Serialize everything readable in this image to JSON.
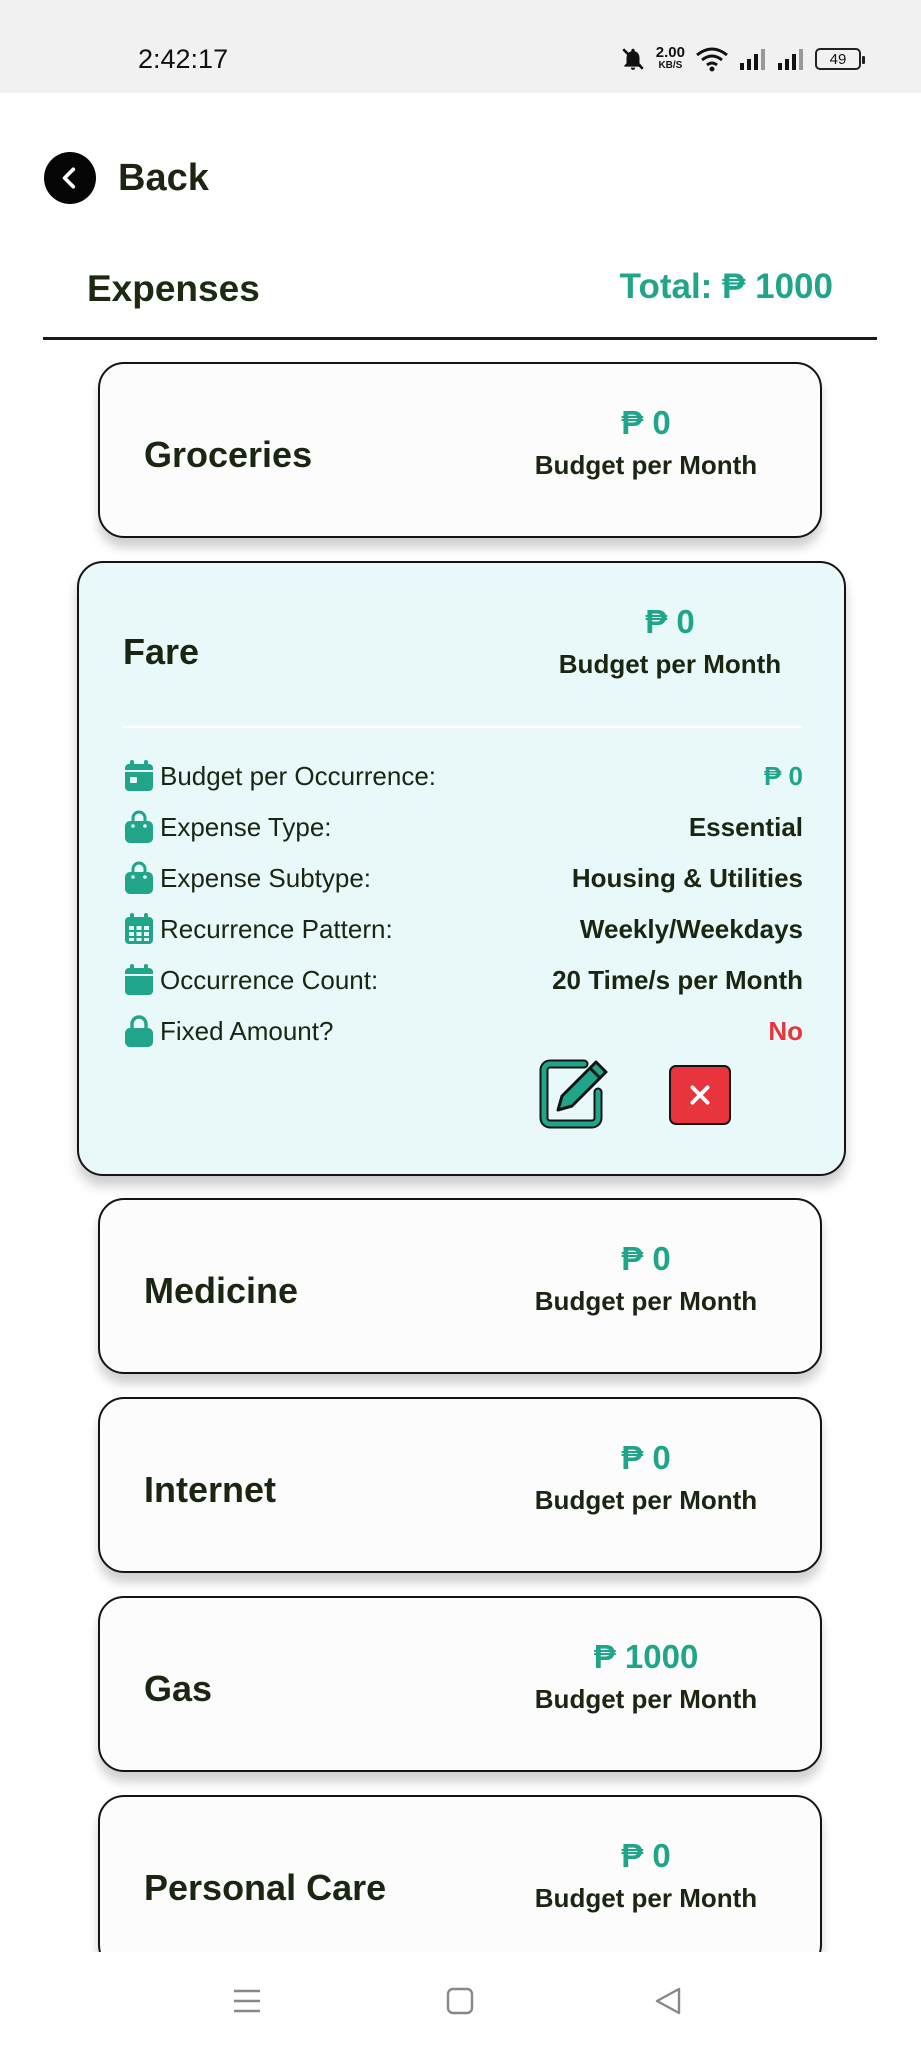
{
  "status_bar": {
    "time": "2:42:17",
    "net_speed_value": "2.00",
    "net_speed_unit": "KB/S",
    "battery": "49"
  },
  "header": {
    "back_label": "Back",
    "title": "Expenses",
    "total": "Total: ₱ 1000"
  },
  "colors": {
    "accent": "#21a58a",
    "danger": "#e8343c",
    "expanded_card_bg": "#e9f8f8"
  },
  "cards": [
    {
      "name": "Groceries",
      "amount": "₱ 0",
      "sub": "Budget per Month"
    },
    {
      "name": "Fare",
      "amount": "₱ 0",
      "sub": "Budget per Month"
    },
    {
      "name": "Medicine",
      "amount": "₱ 0",
      "sub": "Budget per Month"
    },
    {
      "name": "Internet",
      "amount": "₱ 0",
      "sub": "Budget per Month"
    },
    {
      "name": "Gas",
      "amount": "₱ 1000",
      "sub": "Budget per Month"
    },
    {
      "name": "Personal Care",
      "amount": "₱ 0",
      "sub": "Budget per Month"
    }
  ],
  "details": [
    {
      "icon": "calendar-icon",
      "label": "Budget per Occurrence:",
      "value": "₱ 0"
    },
    {
      "icon": "bag-icon",
      "label": "Expense Type:",
      "value": "Essential"
    },
    {
      "icon": "bag-icon",
      "label": "Expense Subtype:",
      "value": "Housing & Utilities"
    },
    {
      "icon": "calendar-grid-icon",
      "label": "Recurrence Pattern:",
      "value": "Weekly/Weekdays"
    },
    {
      "icon": "calendar-icon",
      "label": "Occurrence Count:",
      "value": "20 Time/s per Month"
    },
    {
      "icon": "lock-icon",
      "label": "Fixed Amount?",
      "value": "No"
    }
  ]
}
